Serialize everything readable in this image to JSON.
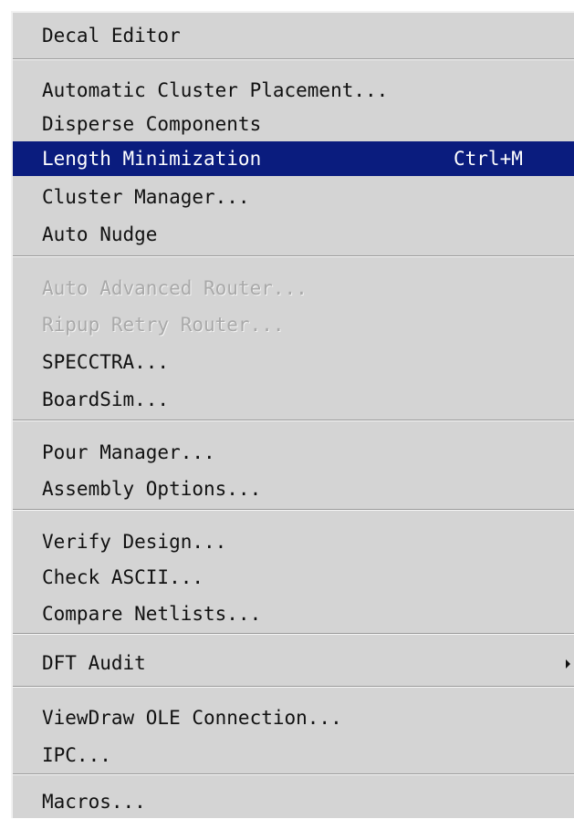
{
  "menu": {
    "items": [
      {
        "label": "Decal Editor",
        "shortcut": "",
        "state": "normal"
      },
      {
        "label": "Automatic Cluster Placement...",
        "shortcut": "",
        "state": "normal"
      },
      {
        "label": "Disperse Components",
        "shortcut": "",
        "state": "normal"
      },
      {
        "label": "Length Minimization",
        "shortcut": "Ctrl+M",
        "state": "highlighted"
      },
      {
        "label": "Cluster Manager...",
        "shortcut": "",
        "state": "normal"
      },
      {
        "label": "Auto Nudge",
        "shortcut": "",
        "state": "normal"
      },
      {
        "label": "Auto Advanced Router...",
        "shortcut": "",
        "state": "disabled"
      },
      {
        "label": "Ripup Retry Router...",
        "shortcut": "",
        "state": "disabled"
      },
      {
        "label": "SPECCTRA...",
        "shortcut": "",
        "state": "normal"
      },
      {
        "label": "BoardSim...",
        "shortcut": "",
        "state": "normal"
      },
      {
        "label": "Pour Manager...",
        "shortcut": "",
        "state": "normal"
      },
      {
        "label": "Assembly Options...",
        "shortcut": "",
        "state": "normal"
      },
      {
        "label": "Verify Design...",
        "shortcut": "",
        "state": "normal"
      },
      {
        "label": "Check ASCII...",
        "shortcut": "",
        "state": "normal"
      },
      {
        "label": "Compare Netlists...",
        "shortcut": "",
        "state": "normal"
      },
      {
        "label": "DFT Audit",
        "shortcut": "",
        "state": "normal",
        "submenu": true
      },
      {
        "label": "ViewDraw OLE Connection...",
        "shortcut": "",
        "state": "normal"
      },
      {
        "label": "IPC...",
        "shortcut": "",
        "state": "normal"
      },
      {
        "label": "Macros...",
        "shortcut": "",
        "state": "normal"
      }
    ]
  },
  "colors": {
    "menu_background": "#d4d4d4",
    "highlight_background": "#0a1c7e",
    "highlight_text": "#ffffff",
    "disabled_text": "#a9a9a9"
  },
  "icons": {
    "submenu_arrow": "chevron-right-icon"
  }
}
